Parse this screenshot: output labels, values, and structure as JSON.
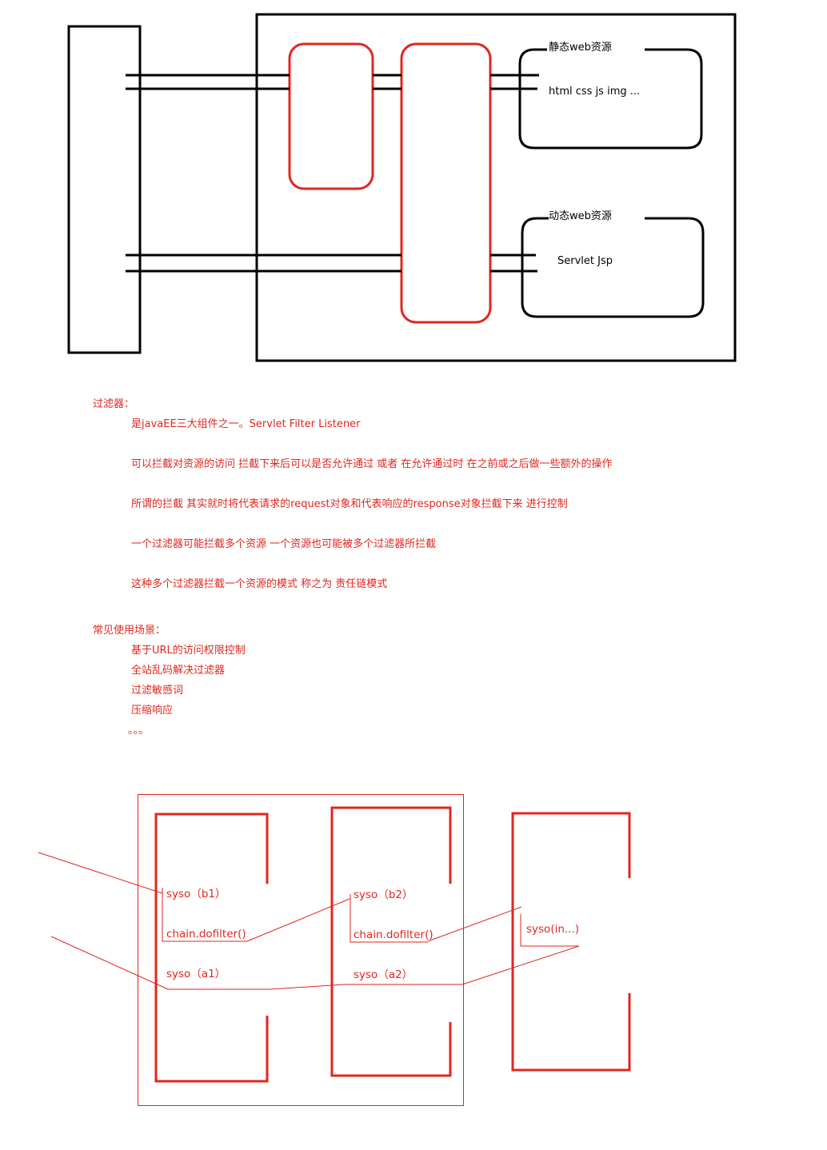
{
  "top_diagram": {
    "static_resource_label": "静态web资源",
    "static_resource_items": "html  css  js  img  ...",
    "dynamic_resource_label": "动态web资源",
    "dynamic_resource_items": "Servlet  Jsp"
  },
  "notes": {
    "filter_heading": "过滤器：",
    "filter_lines": [
      "是javaEE三大组件之一。Servlet Filter Listener",
      "可以拦截对资源的访问 拦截下来后可以是否允许通过 或者 在允许通过时 在之前或之后做一些额外的操作",
      "所谓的拦截 其实就时将代表请求的request对象和代表响应的response对象拦截下来 进行控制",
      "一个过滤器可能拦截多个资源 一个资源也可能被多个过滤器所拦截",
      "这种多个过滤器拦截一个资源的模式 称之为 责任链模式"
    ],
    "scenario_heading": "常见使用场景：",
    "scenario_lines": [
      "基于URL的访问权限控制",
      "全站乱码解决过滤器",
      "过滤敏感词",
      "压缩响应",
      "。。。"
    ]
  },
  "chain_diagram": {
    "filter1_before": "syso（b1）",
    "filter1_chain": "chain.dofilter()",
    "filter1_after": "syso（a1）",
    "filter2_before": "syso（b2）",
    "filter2_chain": "chain.dofilter()",
    "filter2_after": "syso（a2）",
    "resource_output": "syso(in...)"
  },
  "colors": {
    "ink": "#000000",
    "accent": "#e0261f"
  }
}
